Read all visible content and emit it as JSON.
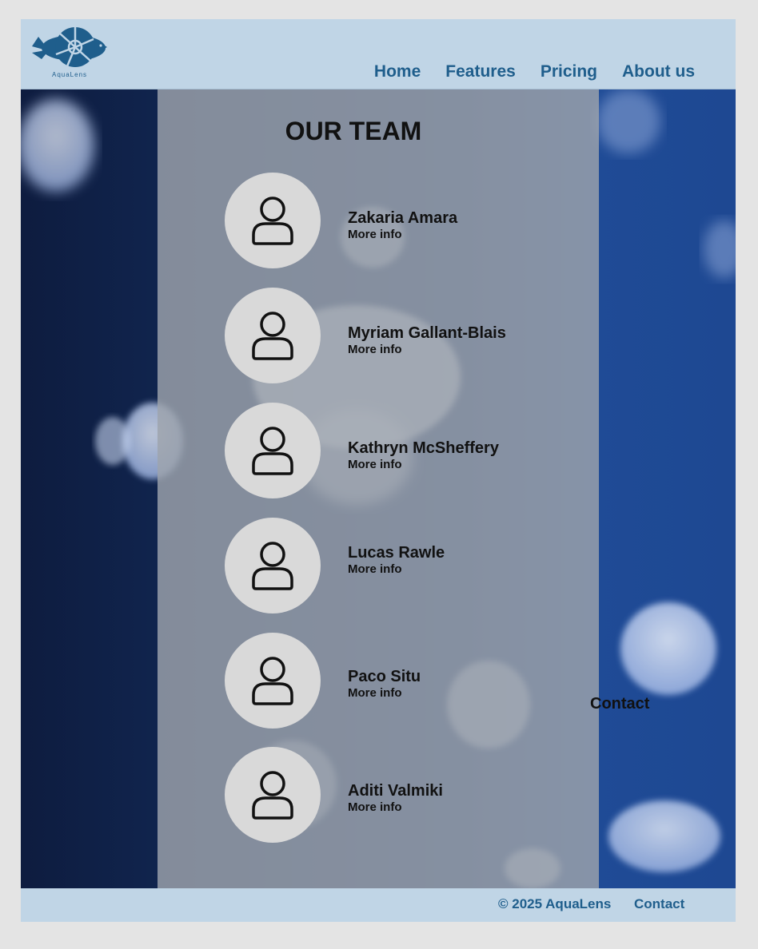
{
  "brand": {
    "name": "AquaLens",
    "logo_text": "AquaLens"
  },
  "nav": {
    "items": [
      "Home",
      "Features",
      "Pricing",
      "About us"
    ]
  },
  "team": {
    "title": "OUR TEAM",
    "members": [
      {
        "name": "Zakaria Amara",
        "info": "More info"
      },
      {
        "name": "Myriam Gallant-Blais",
        "info": "More info"
      },
      {
        "name": "Kathryn McSheffery",
        "info": "More info"
      },
      {
        "name": "Lucas Rawle",
        "info": "More info"
      },
      {
        "name": "Paco Situ",
        "info": "More info"
      },
      {
        "name": "Aditi Valmiki",
        "info": "More info"
      }
    ]
  },
  "side_contact": "Contact",
  "footer": {
    "copyright": "© 2025 AquaLens",
    "contact": "Contact"
  },
  "colors": {
    "header_bg": "#c0d5e6",
    "accent": "#1f5e8c",
    "panel": "#9ea4ac",
    "avatar_bg": "#d9d9d9"
  },
  "icons": {
    "logo": "fish-aperture-logo",
    "avatar": "user-icon"
  }
}
